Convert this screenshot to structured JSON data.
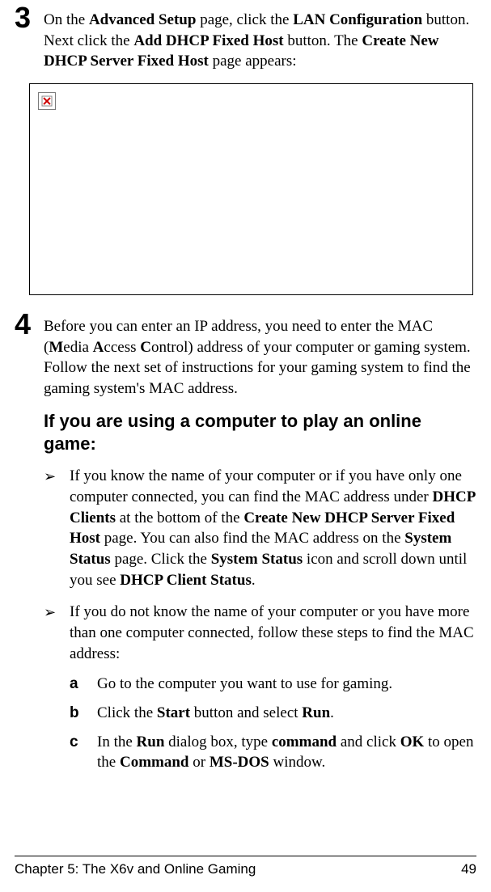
{
  "step3": {
    "num": "3",
    "text_parts": [
      "On the ",
      "Advanced Setup",
      " page, click the ",
      "LAN Configuration",
      " button. Next click the ",
      "Add DHCP Fixed Host",
      " button. The ",
      "Create New DHCP Server Fixed Host",
      " page appears:"
    ]
  },
  "step4": {
    "num": "4",
    "text_parts": [
      "Before you can enter an IP address, you need to enter the MAC (",
      "M",
      "edia ",
      "A",
      "ccess ",
      "C",
      "ontrol) address of your computer or gaming system. Follow the next set of instructions for your gaming system to find the gaming system's MAC address."
    ]
  },
  "subheading": "If you are using a computer to play an online game:",
  "bullet1_parts": [
    "If you know the name of your computer or if you have only one computer connected, you can find the MAC address under ",
    "DHCP Clients",
    " at the bottom of the ",
    "Create New DHCP Server Fixed Host",
    " page. You can also find the MAC address on the ",
    "System Status",
    " page. Click the ",
    "System Status",
    " icon and scroll down until you see ",
    "DHCP Client Status",
    "."
  ],
  "bullet2_intro": "If you do not know the name of your computer or you have more than one computer connected, follow these steps to find the MAC address:",
  "sub_a": {
    "letter": "a",
    "text": "Go to the computer you want to use for gaming."
  },
  "sub_b": {
    "letter": "b",
    "parts": [
      "Click the ",
      "Start",
      " button and select ",
      "Run",
      "."
    ]
  },
  "sub_c": {
    "letter": "c",
    "parts": [
      "In the ",
      "Run",
      " dialog box, type ",
      "command",
      " and click ",
      "OK",
      " to open the ",
      "Command",
      " or ",
      "MS-DOS",
      " window."
    ]
  },
  "footer": {
    "chapter": "Chapter 5: The X6v and Online Gaming",
    "page": "49"
  },
  "arrow_glyph": "➢"
}
